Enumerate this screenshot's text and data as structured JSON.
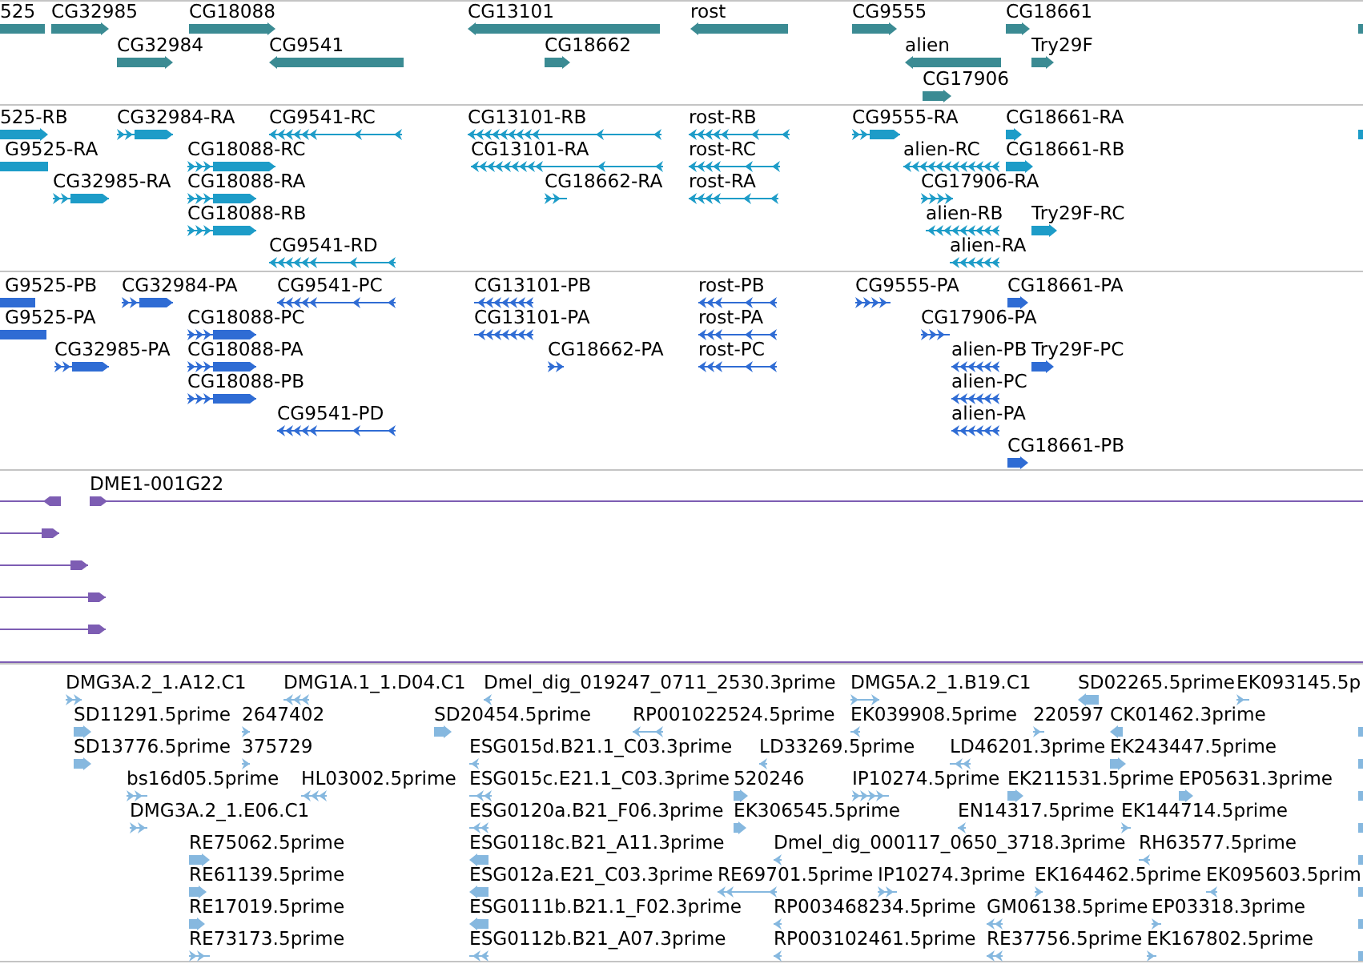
{
  "tracks": [
    {
      "kind": "gene",
      "rows": [
        {
          "cut_off_right": true,
          "features": [
            {
              "label": "525"
            },
            {
              "label": "CG32985",
              "reverse": false
            },
            {
              "label": "CG18088",
              "reverse": false
            },
            {
              "label": "CG13101",
              "reverse": true
            },
            {
              "label": "rost",
              "reverse": true
            },
            {
              "label": "CG9555",
              "reverse": false
            },
            {
              "label": "CG18661",
              "reverse": false
            }
          ]
        },
        {
          "features": [
            {
              "label": "CG32984",
              "reverse": false
            },
            {
              "label": "CG9541",
              "reverse": true
            },
            {
              "label": "CG18662",
              "reverse": false
            },
            {
              "label": "alien",
              "reverse": true
            },
            {
              "label": "Try29F",
              "reverse": false
            }
          ]
        },
        {
          "features": [
            {
              "label": "CG17906",
              "reverse": false
            }
          ]
        }
      ]
    },
    {
      "kind": "transcript",
      "rows": [
        {
          "cut_off_right": true,
          "features": [
            {
              "label": "525-RB",
              "reverse": false
            },
            {
              "label": "CG32984-RA",
              "reverse": false
            },
            {
              "label": "CG9541-RC",
              "reverse": true
            },
            {
              "label": "CG13101-RB",
              "reverse": true
            },
            {
              "label": "rost-RB",
              "reverse": true
            },
            {
              "label": "CG9555-RA",
              "reverse": false
            },
            {
              "label": "CG18661-RA",
              "reverse": false
            }
          ]
        },
        {
          "features": [
            {
              "label": "G9525-RA"
            },
            {
              "label": "CG18088-RC",
              "reverse": false
            },
            {
              "label": "CG13101-RA",
              "reverse": true
            },
            {
              "label": "rost-RC",
              "reverse": true
            },
            {
              "label": "alien-RC",
              "reverse": true
            },
            {
              "label": "CG18661-RB",
              "reverse": false
            }
          ]
        },
        {
          "features": [
            {
              "label": "CG32985-RA",
              "reverse": false
            },
            {
              "label": "CG18088-RA",
              "reverse": false
            },
            {
              "label": "CG18662-RA",
              "reverse": false
            },
            {
              "label": "rost-RA",
              "reverse": true
            },
            {
              "label": "CG17906-RA",
              "reverse": false
            }
          ]
        },
        {
          "features": [
            {
              "label": "CG18088-RB",
              "reverse": false
            },
            {
              "label": "alien-RB",
              "reverse": true
            },
            {
              "label": "Try29F-RC",
              "reverse": false
            }
          ]
        },
        {
          "features": [
            {
              "label": "CG9541-RD",
              "reverse": true
            },
            {
              "label": "alien-RA",
              "reverse": true
            }
          ]
        }
      ]
    },
    {
      "kind": "protein",
      "rows": [
        {
          "features": [
            {
              "label": "G9525-PB"
            },
            {
              "label": "CG32984-PA",
              "reverse": false
            },
            {
              "label": "CG9541-PC",
              "reverse": true
            },
            {
              "label": "CG13101-PB",
              "reverse": true
            },
            {
              "label": "rost-PB",
              "reverse": true
            },
            {
              "label": "CG9555-PA",
              "reverse": false
            },
            {
              "label": "CG18661-PA",
              "reverse": false
            }
          ]
        },
        {
          "features": [
            {
              "label": "G9525-PA"
            },
            {
              "label": "CG18088-PC",
              "reverse": false
            },
            {
              "label": "CG13101-PA",
              "reverse": true
            },
            {
              "label": "rost-PA",
              "reverse": true
            },
            {
              "label": "CG17906-PA",
              "reverse": false
            }
          ]
        },
        {
          "features": [
            {
              "label": "CG32985-PA",
              "reverse": false
            },
            {
              "label": "CG18088-PA",
              "reverse": false
            },
            {
              "label": "CG18662-PA",
              "reverse": false
            },
            {
              "label": "rost-PC",
              "reverse": true
            },
            {
              "label": "alien-PB",
              "reverse": true
            },
            {
              "label": "Try29F-PC",
              "reverse": false
            }
          ]
        },
        {
          "features": [
            {
              "label": "CG18088-PB",
              "reverse": false
            },
            {
              "label": "alien-PC",
              "reverse": true
            }
          ]
        },
        {
          "features": [
            {
              "label": "CG9541-PD",
              "reverse": true
            },
            {
              "label": "alien-PA",
              "reverse": true
            }
          ]
        },
        {
          "features": [
            {
              "label": "CG18661-PB",
              "reverse": false
            }
          ]
        }
      ]
    },
    {
      "kind": "clone",
      "rows": [
        {
          "features": [
            {
              "reverse": true
            },
            {
              "label": "DME1-001G22",
              "reverse": false
            }
          ]
        },
        {
          "features": [
            {
              "reverse": false
            }
          ]
        },
        {
          "features": [
            {
              "reverse": false
            }
          ]
        },
        {
          "features": [
            {
              "reverse": false
            }
          ]
        },
        {
          "features": [
            {
              "reverse": false
            }
          ]
        }
      ]
    },
    {
      "kind": "est",
      "rows": [
        {
          "features": [
            {
              "label": "DMG3A.2_1.A12.C1",
              "reverse": false
            },
            {
              "label": "DMG1A.1_1.D04.C1",
              "reverse": true
            },
            {
              "label": "Dmel_dig_019247_0711_2530.3prime",
              "reverse": true
            },
            {
              "label": "DMG5A.2_1.B19.C1",
              "reverse": false
            },
            {
              "label": "SD02265.5prime",
              "reverse": true
            },
            {
              "label": "EK093145.5p",
              "reverse": false
            }
          ]
        },
        {
          "cut_off_right": true,
          "features": [
            {
              "label": "SD11291.5prime",
              "reverse": false
            },
            {
              "label": "2647402",
              "reverse": false
            },
            {
              "label": "SD20454.5prime",
              "reverse": false
            },
            {
              "label": "RP001022524.5prime",
              "reverse": true
            },
            {
              "label": "EK039908.5prime",
              "reverse": true
            },
            {
              "label": "220597",
              "reverse": false
            },
            {
              "label": "CK01462.3prime",
              "reverse": true
            }
          ]
        },
        {
          "cut_off_right": true,
          "features": [
            {
              "label": "SD13776.5prime",
              "reverse": false
            },
            {
              "label": "375729",
              "reverse": false
            },
            {
              "label": "ESG015d.B21.1_C03.3prime",
              "reverse": true
            },
            {
              "label": "LD33269.5prime",
              "reverse": true
            },
            {
              "label": "LD46201.3prime",
              "reverse": true
            },
            {
              "label": "EK243447.5prime",
              "reverse": false
            }
          ]
        },
        {
          "cut_off_right": true,
          "features": [
            {
              "label": "bs16d05.5prime",
              "reverse": false
            },
            {
              "label": "HL03002.5prime",
              "reverse": true
            },
            {
              "label": "ESG015c.E21.1_C03.3prime",
              "reverse": true
            },
            {
              "label": "520246",
              "reverse": false
            },
            {
              "label": "IP10274.5prime",
              "reverse": false
            },
            {
              "label": "EK211531.5prime",
              "reverse": false
            },
            {
              "label": "EP05631.3prime",
              "reverse": false
            }
          ]
        },
        {
          "cut_off_right": true,
          "features": [
            {
              "label": "DMG3A.2_1.E06.C1",
              "reverse": false
            },
            {
              "label": "ESG0120a.B21_F06.3prime",
              "reverse": true
            },
            {
              "label": "EK306545.5prime",
              "reverse": false
            },
            {
              "label": "EN14317.5prime",
              "reverse": true
            },
            {
              "label": "EK144714.5prime",
              "reverse": false
            }
          ]
        },
        {
          "cut_off_right": true,
          "features": [
            {
              "label": "RE75062.5prime",
              "reverse": false
            },
            {
              "label": "ESG0118c.B21_A11.3prime",
              "reverse": true
            },
            {
              "label": "Dmel_dig_000117_0650_3718.3prime",
              "reverse": true
            },
            {
              "label": "RH63577.5prime",
              "reverse": true
            }
          ]
        },
        {
          "cut_off_right": true,
          "features": [
            {
              "label": "RE61139.5prime",
              "reverse": false
            },
            {
              "label": "ESG012a.E21_C03.3prime",
              "reverse": true
            },
            {
              "label": "RE69701.5prime",
              "reverse": true
            },
            {
              "label": "IP10274.3prime",
              "reverse": false
            },
            {
              "label": "EK164462.5prime",
              "reverse": false
            },
            {
              "label": "EK095603.5prim",
              "reverse": true
            }
          ]
        },
        {
          "cut_off_right": true,
          "features": [
            {
              "label": "RE17019.5prime",
              "reverse": false
            },
            {
              "label": "ESG0111b.B21.1_F02.3prime",
              "reverse": true
            },
            {
              "label": "RP003468234.5prime",
              "reverse": true
            },
            {
              "label": "GM06138.5prime",
              "reverse": true
            },
            {
              "label": "EP03318.3prime",
              "reverse": false
            }
          ]
        },
        {
          "cut_off_right": true,
          "features": [
            {
              "label": "RE73173.5prime",
              "reverse": false
            },
            {
              "label": "ESG0112b.B21_A07.3prime",
              "reverse": true
            },
            {
              "label": "RP003102461.5prime",
              "reverse": true
            },
            {
              "label": "RE37756.5prime",
              "reverse": true
            },
            {
              "label": "EK167802.5prime",
              "reverse": false
            }
          ]
        }
      ]
    }
  ]
}
